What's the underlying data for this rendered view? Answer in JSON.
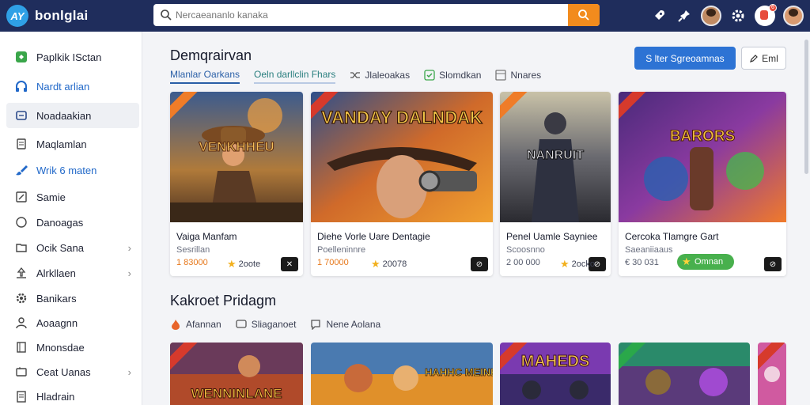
{
  "brand": {
    "logo": "AY",
    "name": "bonlglai"
  },
  "search": {
    "placeholder": "Nercaeananlo kanaka",
    "value": ""
  },
  "top_icons": [
    "rocket-icon",
    "pin-icon",
    "user-avatar-icon",
    "settings-icon",
    "notification-icon",
    "profile-avatar"
  ],
  "notification_count": "6",
  "sidebar": {
    "items": [
      {
        "label": "Paplkik ISctan",
        "icon": "game-controller-icon"
      },
      {
        "label": "Nardt arlian",
        "icon": "headphones-icon",
        "blue": true
      },
      {
        "label": "Noadaakian",
        "icon": "library-icon",
        "active": true
      },
      {
        "label": "Maqlamlan",
        "icon": "document-icon"
      },
      {
        "label": "Wrik 6 maten",
        "icon": "brush-icon",
        "blue": true
      },
      {
        "label": "Samie",
        "icon": "edit-icon"
      },
      {
        "label": "Danoagas",
        "icon": "circle-icon"
      },
      {
        "label": "Ocik Sana",
        "icon": "folder-icon",
        "chevron": true
      },
      {
        "label": "Alrkllaen",
        "icon": "upload-icon",
        "chevron": true
      },
      {
        "label": "Banikars",
        "icon": "gear-icon"
      },
      {
        "label": "Aoaagnn",
        "icon": "person-icon"
      },
      {
        "label": "Mnonsdae",
        "icon": "list-icon"
      },
      {
        "label": "Ceat Uanas",
        "icon": "trophy-icon",
        "chevron": true
      },
      {
        "label": "Hladrain",
        "icon": "notes-icon"
      }
    ]
  },
  "section1": {
    "title": "Demqrairvan",
    "tabs": [
      {
        "label": "Mlanlar Oarkans",
        "active": true
      },
      {
        "label": "Oeln darllclin Fhars",
        "secondary": true
      },
      {
        "label": "Jlaleoakas",
        "icon": "shuffle-icon"
      },
      {
        "label": "Slomdkan",
        "icon": "check-icon"
      },
      {
        "label": "Nnares",
        "icon": "grid-icon"
      }
    ],
    "primary_button": "S lter Sgreoamnas",
    "outline_button": "Eml",
    "cards": [
      {
        "art_text": "VENKHHEU",
        "title": "Vaiga Manfam",
        "sub": "Sesrillan",
        "price": "1 83000",
        "rating": "2oote",
        "corner": "✕"
      },
      {
        "art_text": "VANDAY DALNDAK",
        "title": "Diehe Vorle Uare Dentagie",
        "sub": "Poelleninnre",
        "price": "1 70000",
        "rating": "20078",
        "corner": "⊘"
      },
      {
        "art_text": "NANRUIT",
        "title": "Penel Uamle Sayniee",
        "sub": "Scoosnno",
        "price": "2 00 000",
        "rating": "2ocko",
        "corner": "⊘"
      },
      {
        "art_text": "BARORS",
        "title": "Cercoka Tlamgre Gart",
        "sub": "Saeaniiaaus",
        "price": "€ 30 031",
        "pill": "Omnan",
        "corner": "⊘"
      }
    ]
  },
  "section2": {
    "title": "Kakroet Pridagm",
    "tabs": [
      {
        "label": "Afannan",
        "icon": "fire-icon"
      },
      {
        "label": "Sliaganoet",
        "icon": "chat-icon"
      },
      {
        "label": "Nene Aolana",
        "icon": "comment-icon"
      }
    ],
    "cards": [
      {
        "art_text": "WENNINLANE"
      },
      {
        "art_text": "HAHHC MEINE"
      },
      {
        "art_text": "MAHEDS"
      },
      {
        "art_text": ""
      },
      {
        "art_text": ""
      }
    ]
  },
  "colors": {
    "topbar": "#1f2d5c",
    "accent_orange": "#f28b1d",
    "primary_blue": "#2d73d4",
    "price_orange": "#e6781c",
    "rating_star": "#f2b01e",
    "pill_green": "#48b04d"
  }
}
